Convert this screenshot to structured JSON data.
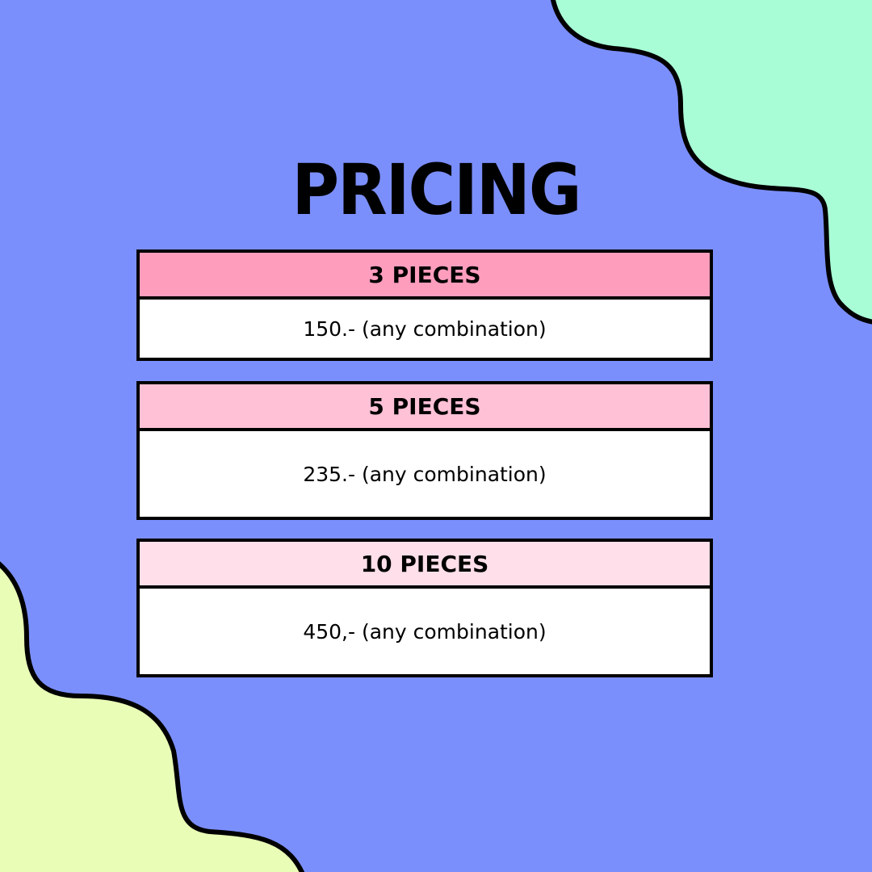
{
  "title": "PRICING",
  "colors": {
    "background": "#7b8ffc",
    "blob_top_right": "#a8fdd6",
    "blob_bottom_left": "#e9fdb6",
    "outline": "#000000"
  },
  "tiers": [
    {
      "header": "3 PIECES",
      "price": "150.- (any combination)",
      "header_color": "#ff9dbd"
    },
    {
      "header": "5 PIECES",
      "price": "235.- (any combination)",
      "header_color": "#ffc1d6"
    },
    {
      "header": "10 PIECES",
      "price": "450,- (any combination)",
      "header_color": "#ffdfe9"
    }
  ]
}
